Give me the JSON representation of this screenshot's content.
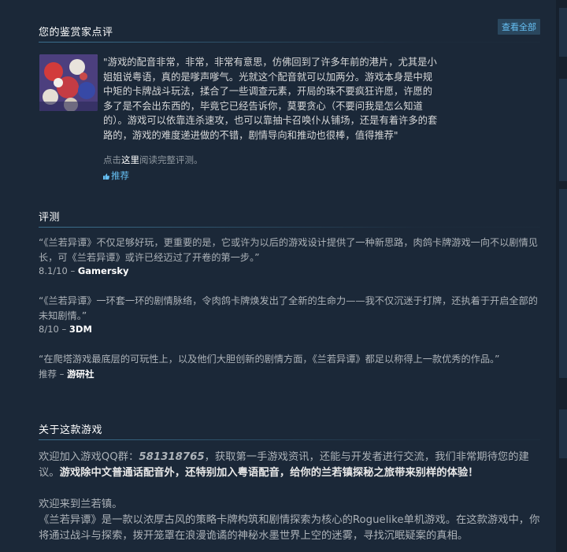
{
  "curator": {
    "section_title": "您的鉴赏家点评",
    "view_all_label": "查看全部",
    "quote": "\"游戏的配音非常，非常，非常有意思，仿佛回到了许多年前的港片，尤其是小姐姐说粤语，真的是嗲声嗲气。光就这个配音就可以加两分。游戏本身是中规中矩的卡牌战斗玩法，揉合了一些调查元素，开局的珠不要疯狂许愿，许愿的多了是不会出东西的，毕竟它已经告诉你，莫要贪心（不要问我是怎么知道的）。游戏可以依靠连杀速攻，也可以靠抽卡召唤仆从铺场，还是有着许多的套路的，游戏的难度递进做的不错，剧情导向和推动也很棒，值得推荐\"",
    "read_more_prefix": "点击",
    "read_more_link": "这里",
    "read_more_suffix": "阅读完整评测。",
    "recommend_label": "推荐"
  },
  "reviews": {
    "section_title": "评测",
    "items": [
      {
        "quote": "“《兰若异谭》不仅足够好玩，更重要的是，它或许为以后的游戏设计提供了一种新思路，肉鸽卡牌游戏一向不以剧情见长，可《兰若异谭》或许已经迈过了开卷的第一步。”",
        "score": "8.1/10 – ",
        "source": "Gamersky"
      },
      {
        "quote": "“《兰若异谭》一环套一环的剧情脉络，令肉鸽卡牌焕发出了全新的生命力——我不仅沉迷于打牌，还执着于开启全部的未知剧情。”",
        "score": "8/10 – ",
        "source": "3DM"
      },
      {
        "quote": "“在爬塔游戏最底层的可玩性上，以及他们大胆创新的剧情方面，《兰若异谭》都足以称得上一款优秀的作品。”",
        "score": "推荐 – ",
        "source": "游研社"
      }
    ]
  },
  "about": {
    "section_title": "关于这款游戏",
    "p1_prefix": "欢迎加入游戏QQ群：",
    "qq_number": "581318765",
    "p1_mid": "，获取第一手游戏资讯，还能与开发者进行交流，我们非常期待您的建议。",
    "p1_bold": "游戏除中文普通话配音外，还特别加入粤语配音，给你的兰若镇探秘之旅带来别样的体验！",
    "p2_line1": "欢迎来到兰若镇。",
    "p2_line2": "《兰若异谭》是一款以浓厚古风的策略卡牌构筑和剧情探索为核心的Roguelike单机游戏。在这款游戏中，你将通过战斗与探索，拨开笼罩在浪漫诡谲的神秘水墨世界上空的迷雾，寻找沉眠疑案的真相。"
  }
}
